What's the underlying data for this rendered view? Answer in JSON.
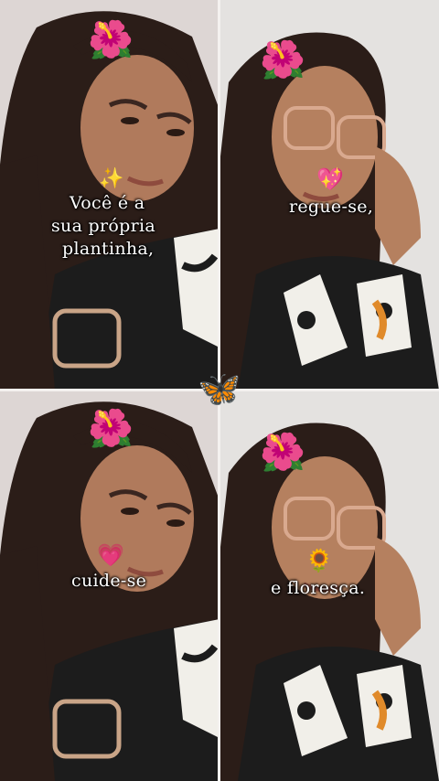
{
  "panels": [
    {
      "caption_lines": [
        "Você é a",
        "sua própria",
        "plantinha,"
      ],
      "emoji": "sparkles-emoji"
    },
    {
      "caption_lines": [
        "regue-se,"
      ],
      "emoji": "sparkling-heart-emoji"
    },
    {
      "caption_lines": [
        "cuide-se"
      ],
      "emoji": "pink-heart-emoji"
    },
    {
      "caption_lines": [
        "e floresça."
      ],
      "emoji": "sunflower-emoji"
    }
  ],
  "decorations": {
    "flower": "hibiscus-emoji",
    "center": "butterfly-emoji"
  },
  "colors": {
    "hair": "#2b1d18",
    "skin": "#b07a5c",
    "hibiscus": "#e0182f",
    "pink_flower": "#e8336b",
    "butterfly": "#2f8fe0"
  }
}
